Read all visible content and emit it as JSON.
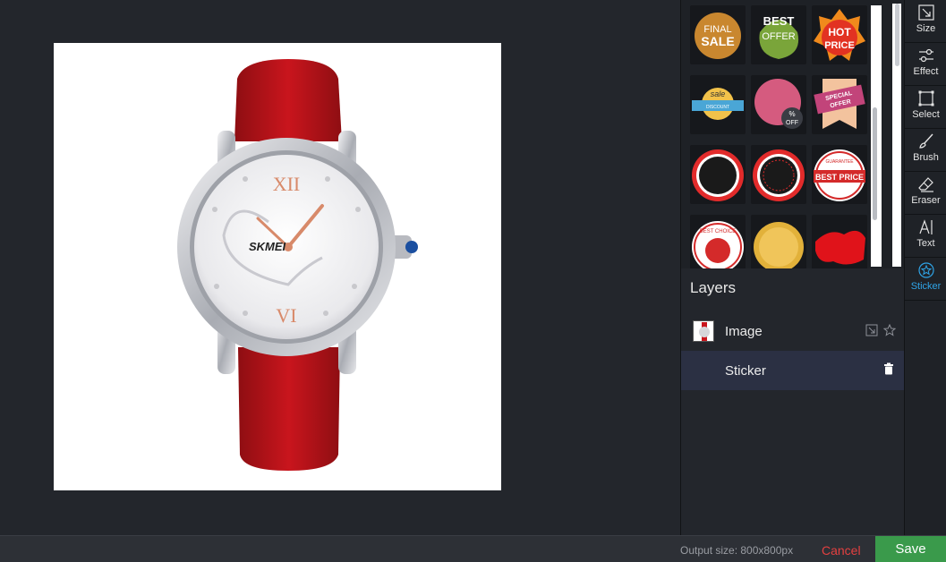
{
  "canvas": {
    "watch_brand": "SKMEI"
  },
  "stickers": [
    {
      "name": "final-sale",
      "line1": "FINAL",
      "line2": "SALE"
    },
    {
      "name": "best-offer",
      "line1": "BEST",
      "line2": "OFFER"
    },
    {
      "name": "hot-price",
      "line1": "HOT",
      "line2": "PRICE"
    },
    {
      "name": "sale-ribbon",
      "line1": "sale",
      "line2": "DISCOUNT"
    },
    {
      "name": "pink-circle",
      "line1": "%",
      "line2": "OFF"
    },
    {
      "name": "special-offer",
      "line1": "SPECIAL",
      "line2": "OFFER"
    },
    {
      "name": "red-badge-1",
      "line1": "",
      "line2": ""
    },
    {
      "name": "red-badge-2",
      "line1": "",
      "line2": ""
    },
    {
      "name": "best-price",
      "line1": "GUARANTEE",
      "line2": "BEST PRICE"
    },
    {
      "name": "best-choice",
      "line1": "BEST CHOICE",
      "line2": ""
    },
    {
      "name": "thumbs-seal",
      "line1": "",
      "line2": ""
    },
    {
      "name": "red-splash",
      "line1": "",
      "line2": ""
    }
  ],
  "layers": {
    "title": "Layers",
    "items": [
      {
        "label": "Image"
      },
      {
        "label": "Sticker"
      }
    ]
  },
  "tools": [
    {
      "label": "Size",
      "icon": "resize-icon"
    },
    {
      "label": "Effect",
      "icon": "sliders-icon"
    },
    {
      "label": "Select",
      "icon": "select-icon"
    },
    {
      "label": "Brush",
      "icon": "brush-icon"
    },
    {
      "label": "Eraser",
      "icon": "eraser-icon"
    },
    {
      "label": "Text",
      "icon": "text-icon"
    },
    {
      "label": "Sticker",
      "icon": "sticker-icon",
      "active": true
    }
  ],
  "footer": {
    "output_size": "Output size: 800x800px",
    "cancel": "Cancel",
    "save": "Save"
  },
  "colors": {
    "accent": "#2fa4e7",
    "save": "#3a9a4b",
    "cancel": "#e34040",
    "selected_layer": "#2b3043"
  }
}
